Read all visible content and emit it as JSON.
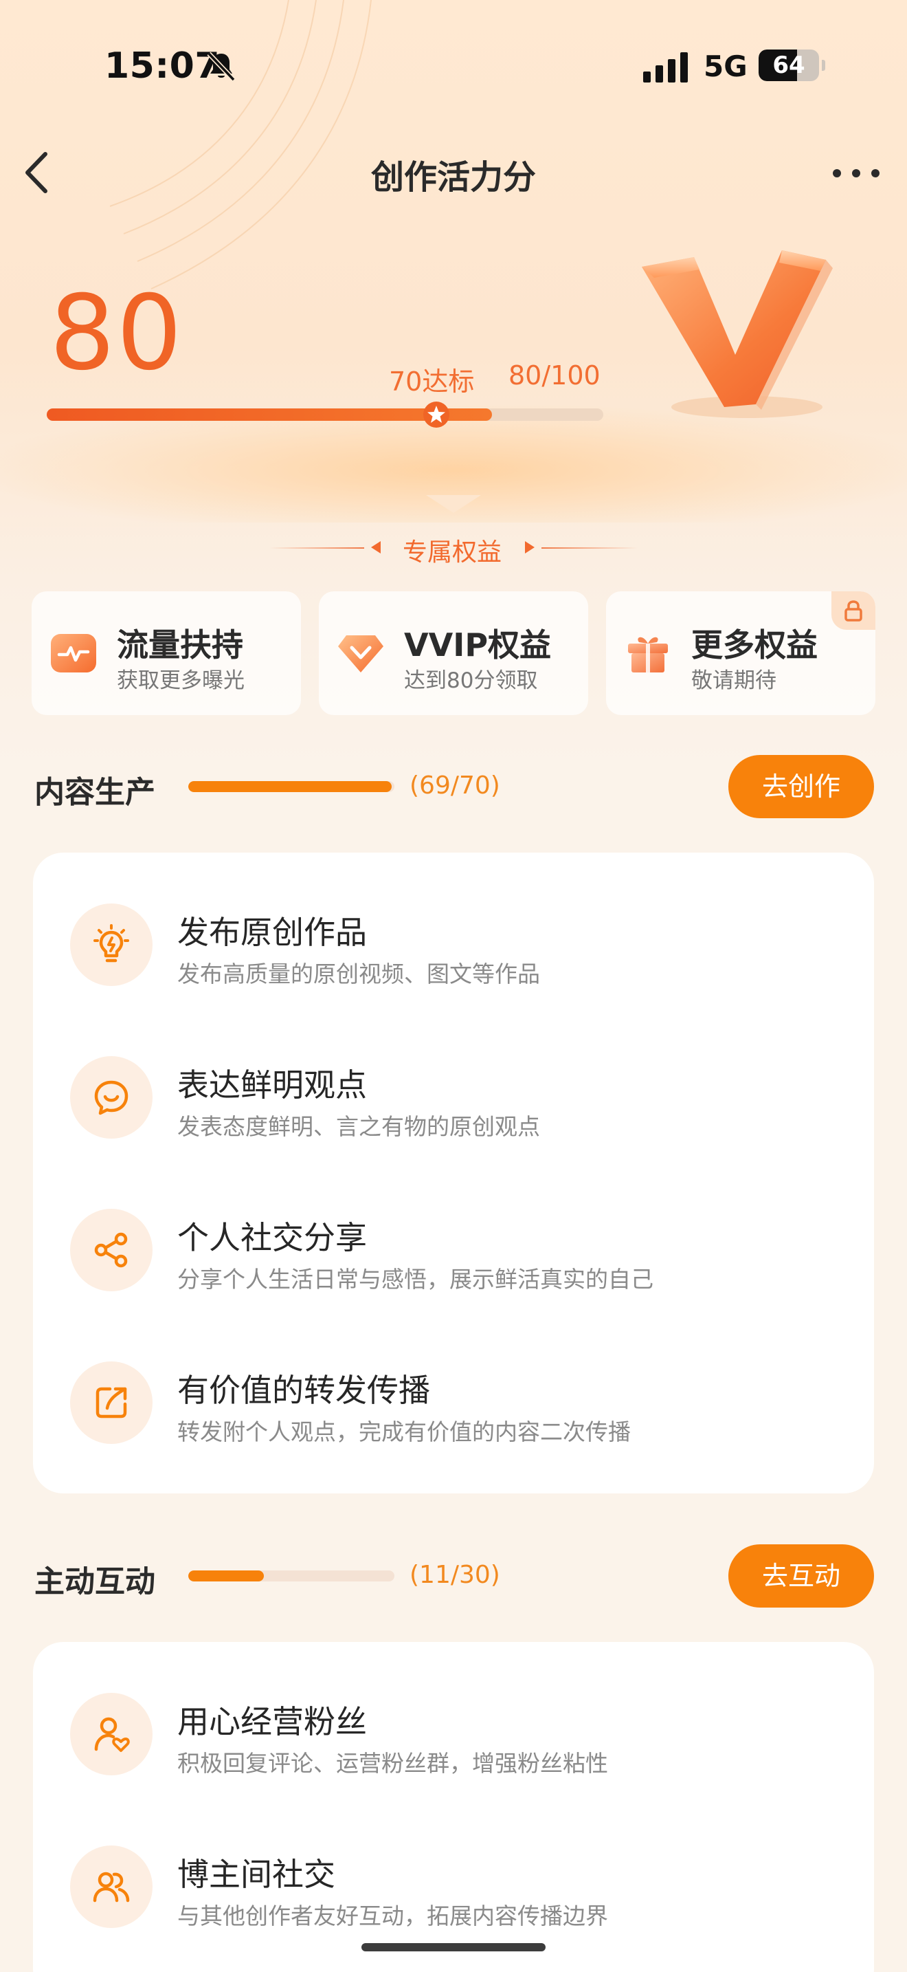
{
  "status_bar": {
    "time": "15:07",
    "network": "5G",
    "battery": "64",
    "battery_level": 0.64
  },
  "nav": {
    "title": "创作活力分"
  },
  "score": {
    "value": "80",
    "target_label": "70达标",
    "fraction": "80/100",
    "progress": 0.8,
    "target_marker": 0.7
  },
  "benefits": {
    "header": "专属权益",
    "items": [
      {
        "title": "流量扶持",
        "subtitle": "获取更多曝光",
        "icon": "traffic-chart-icon"
      },
      {
        "title": "VVIP权益",
        "subtitle": "达到80分领取",
        "icon": "diamond-icon"
      },
      {
        "title": "更多权益",
        "subtitle": "敬请期待",
        "icon": "gift-icon",
        "locked": true
      }
    ]
  },
  "content_section": {
    "title": "内容生产",
    "count": "(69/70)",
    "progress": 0.986,
    "button": "去创作",
    "items": [
      {
        "title": "发布原创作品",
        "desc": "发布高质量的原创视频、图文等作品",
        "icon": "lightbulb-icon"
      },
      {
        "title": "表达鲜明观点",
        "desc": "发表态度鲜明、言之有物的原创观点",
        "icon": "speech-bubble-icon"
      },
      {
        "title": "个人社交分享",
        "desc": "分享个人生活日常与感悟，展示鲜活真实的自己",
        "icon": "share-icon"
      },
      {
        "title": "有价值的转发传播",
        "desc": "转发附个人观点，完成有价值的内容二次传播",
        "icon": "forward-icon"
      }
    ]
  },
  "interaction_section": {
    "title": "主动互动",
    "count": "(11/30)",
    "progress": 0.367,
    "button": "去互动",
    "items": [
      {
        "title": "用心经营粉丝",
        "desc": "积极回复评论、运营粉丝群，增强粉丝粘性",
        "icon": "user-heart-icon"
      },
      {
        "title": "博主间社交",
        "desc": "与其他创作者友好互动，拓展内容传播边界",
        "icon": "users-icon"
      }
    ]
  },
  "colors": {
    "accent": "#f8820b",
    "score": "#f06426",
    "background": "#fbf3ea"
  }
}
